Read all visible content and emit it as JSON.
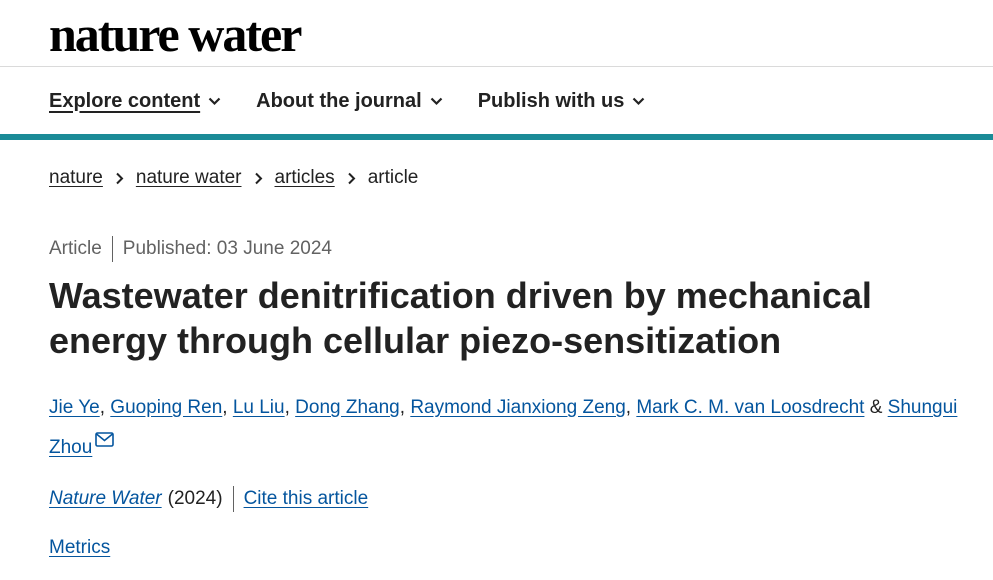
{
  "site": {
    "logo_text": "nature water"
  },
  "nav": {
    "items": [
      {
        "label": "Explore content",
        "active": true
      },
      {
        "label": "About the journal",
        "active": false
      },
      {
        "label": "Publish with us",
        "active": false
      }
    ]
  },
  "breadcrumb": [
    "nature",
    "nature water",
    "articles",
    "article"
  ],
  "article": {
    "type": "Article",
    "published": "Published: 03 June 2024",
    "title": "Wastewater denitrification driven by mechanical energy through cellular piezo-sensitization",
    "authors": [
      "Jie Ye",
      "Guoping Ren",
      "Lu Liu",
      "Dong Zhang",
      "Raymond Jianxiong Zeng",
      "Mark C. M. van Loosdrecht",
      "Shungui Zhou"
    ],
    "author_separator": ", ",
    "author_last_separator": " & ",
    "journal": "Nature Water",
    "year": "(2024)",
    "cite_label": "Cite this article",
    "metrics_label": "Metrics"
  },
  "colors": {
    "accent": "#1a8b97",
    "link": "#04559e",
    "text": "#222222",
    "muted": "#626262"
  },
  "icons": {
    "nav_chevron": "chevron-down-icon",
    "breadcrumb_sep": "chevron-right-icon",
    "corresponding": "mail-icon"
  }
}
